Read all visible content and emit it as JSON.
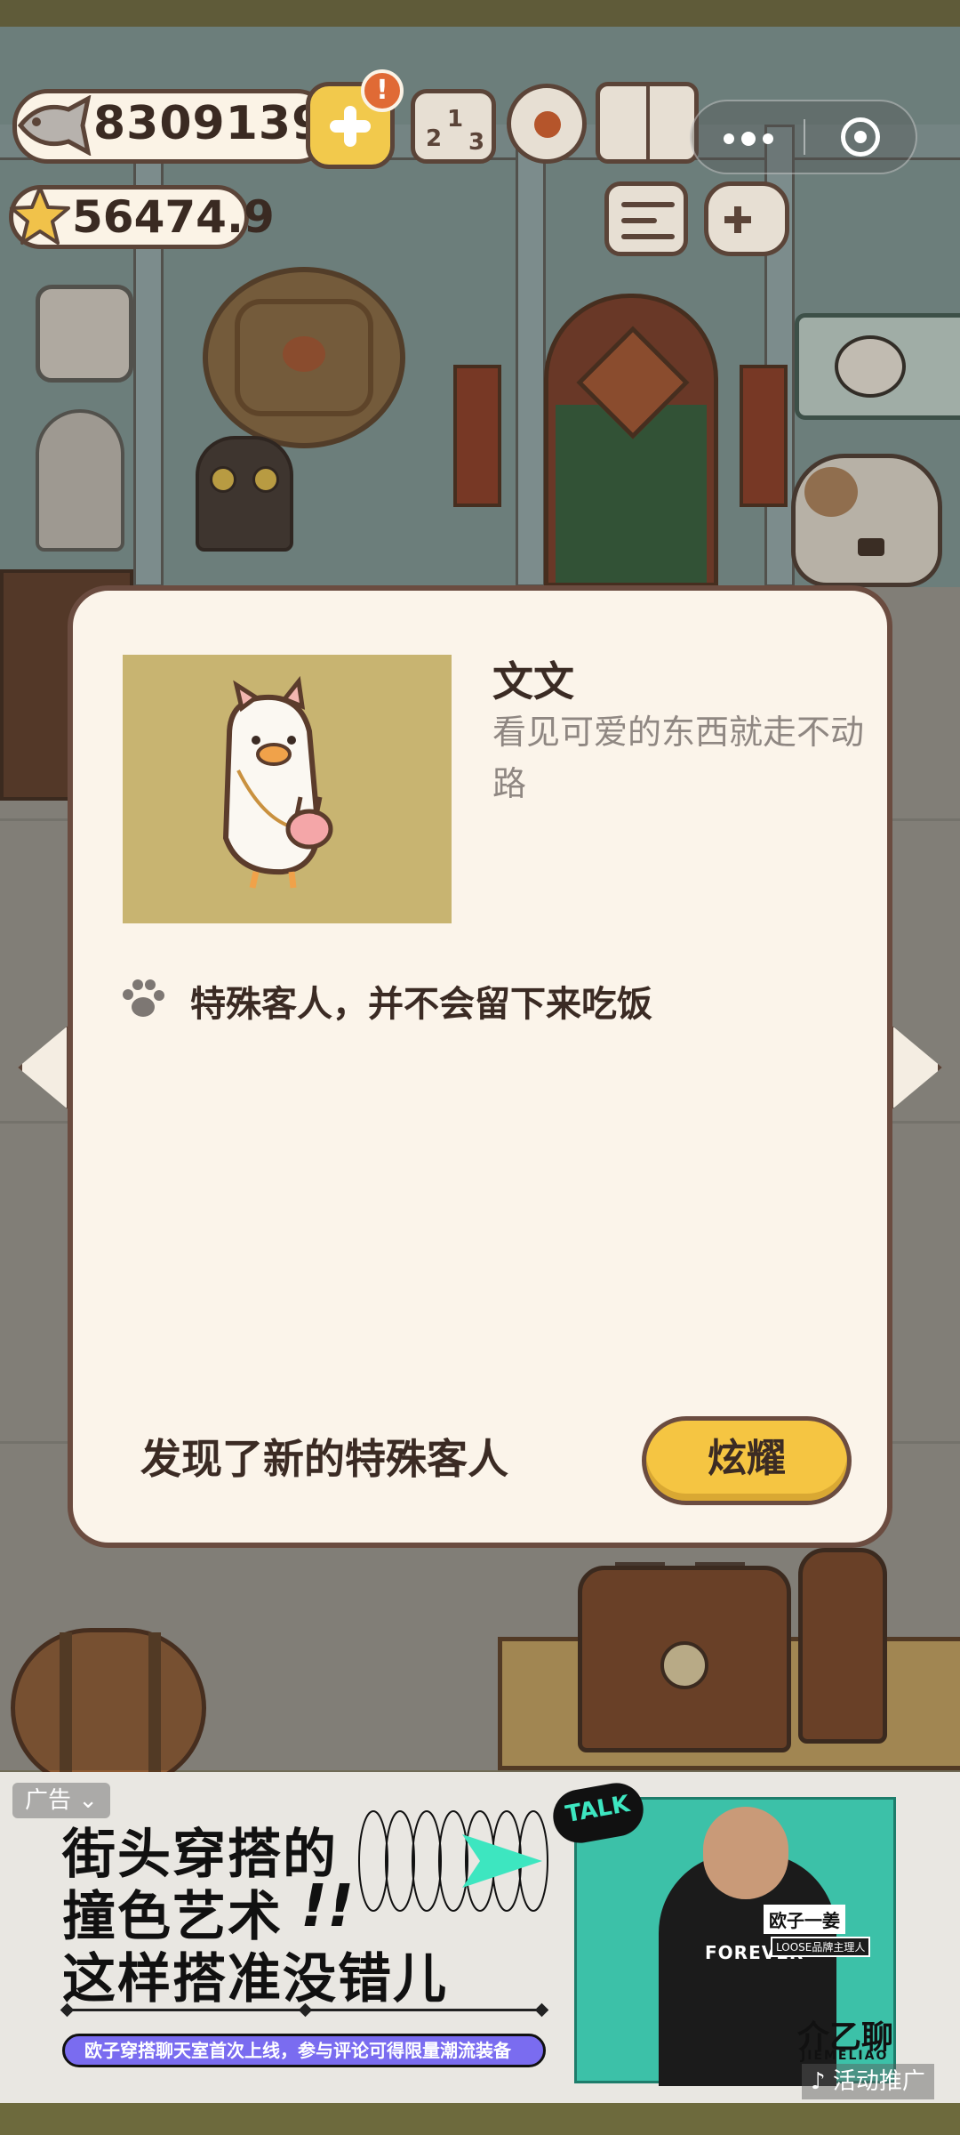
{
  "hud": {
    "fish_currency": "8309139",
    "star_currency": "56474.9",
    "alert_badge": "!",
    "rank_digits": [
      "2",
      "1",
      "3"
    ]
  },
  "modal": {
    "guest_name": "文文",
    "guest_description": "看见可爱的东西就走不动路",
    "note": "特殊客人，并不会留下来吃饭",
    "footer_message": "发现了新的特殊客人",
    "show_off_button": "炫耀"
  },
  "ad": {
    "tag": "广告",
    "headline_1": "街头穿搭的",
    "headline_2": "撞色艺术",
    "headline_2_marks": "!!",
    "headline_3": "这样搭准没错儿",
    "slogan": "欧子穿搭聊天室首次上线，参与评论可得限量潮流装备",
    "talk_badge": "TALK",
    "photo_tag": "欧子一姜",
    "photo_tag_sub": "LOOSE品牌主理人",
    "shirt_text": "FOREVER",
    "brand_logo": "介乙聊",
    "brand_logo_sub": "JIEMELIAO",
    "promo_label": "活动推广"
  },
  "colors": {
    "modal_bg": "#fbf4ea",
    "modal_border": "#6b4c40",
    "button_yellow": "#f5c542",
    "portrait_bg": "#c8b471",
    "ad_accent": "#3cc1a8",
    "ad_strip": "#7a6cf0"
  },
  "icons": [
    "fish-icon",
    "plus-icon",
    "star-icon",
    "ranking-icon",
    "flower-icon",
    "recipe-book-icon",
    "news-icon",
    "gamepad-icon",
    "more-dots-icon",
    "close-target-icon",
    "paw-icon",
    "arrow-left-icon",
    "arrow-right-icon"
  ]
}
